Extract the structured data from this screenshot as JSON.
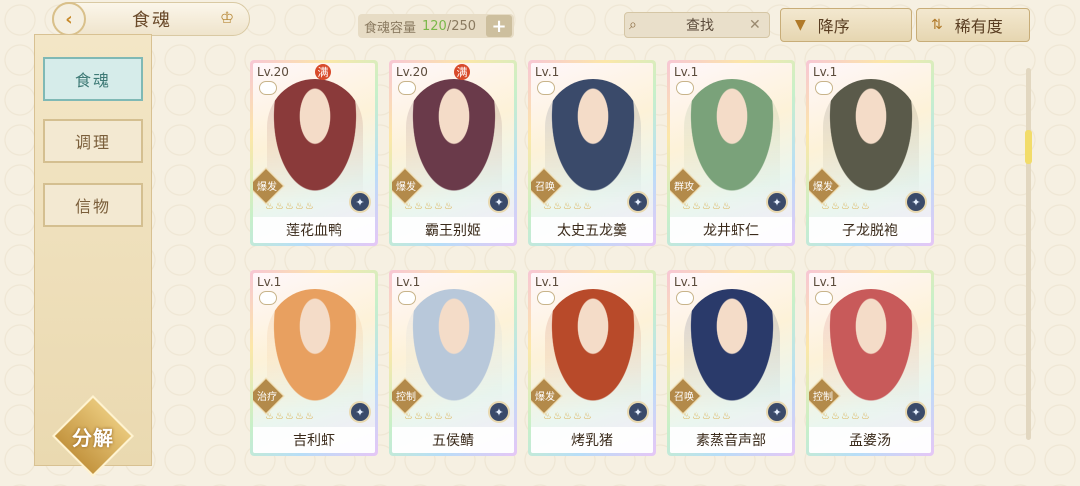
{
  "header": {
    "title": "食魂",
    "capacity_label": "食魂容量",
    "capacity_current": "120",
    "capacity_max": "/250",
    "search_placeholder": "查找",
    "sort_desc_label": "降序",
    "sort_rarity_label": "稀有度"
  },
  "sidebar": {
    "items": [
      {
        "label": "食魂",
        "active": true
      },
      {
        "label": "调理",
        "active": false
      },
      {
        "label": "信物",
        "active": false
      }
    ],
    "decompose_label": "分解"
  },
  "cards": [
    {
      "level": "Lv.20",
      "full": "满",
      "role": "爆发",
      "name": "莲花血鸭",
      "tone": "#8a3a3a"
    },
    {
      "level": "Lv.20",
      "full": "满",
      "role": "爆发",
      "name": "霸王别姬",
      "tone": "#6a3a4a"
    },
    {
      "level": "Lv.1",
      "full": "",
      "role": "召唤",
      "name": "太史五龙羹",
      "tone": "#3a4a6a"
    },
    {
      "level": "Lv.1",
      "full": "",
      "role": "群攻",
      "name": "龙井虾仁",
      "tone": "#7aa27a"
    },
    {
      "level": "Lv.1",
      "full": "",
      "role": "爆发",
      "name": "子龙脱袍",
      "tone": "#5a5a4a"
    },
    {
      "level": "Lv.1",
      "full": "",
      "role": "治疗",
      "name": "吉利虾",
      "tone": "#e8a060"
    },
    {
      "level": "Lv.1",
      "full": "",
      "role": "控制",
      "name": "五侯鲭",
      "tone": "#b8c8da"
    },
    {
      "level": "Lv.1",
      "full": "",
      "role": "爆发",
      "name": "烤乳猪",
      "tone": "#b84a2a"
    },
    {
      "level": "Lv.1",
      "full": "",
      "role": "召唤",
      "name": "素蒸音声部",
      "tone": "#2a3a6a"
    },
    {
      "level": "Lv.1",
      "full": "",
      "role": "控制",
      "name": "孟婆汤",
      "tone": "#c85a5a"
    }
  ]
}
